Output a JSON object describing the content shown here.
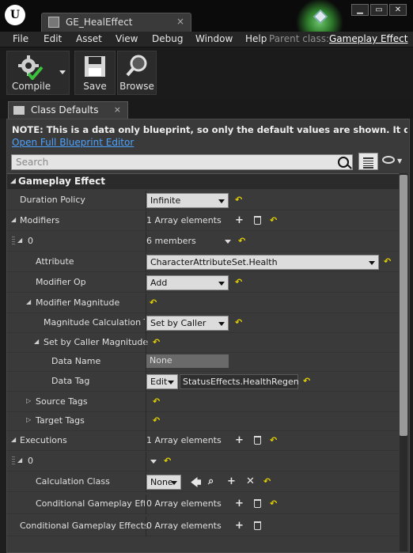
{
  "window": {
    "tab_title": "GE_HealEffect",
    "close_glyph": "×",
    "buttons": [
      "▁",
      "▭",
      "✕"
    ]
  },
  "menu": {
    "items": [
      "File",
      "Edit",
      "Asset",
      "View",
      "Debug",
      "Window",
      "Help"
    ],
    "parent_class_label": "Parent class:",
    "parent_class_value": "Gameplay Effect"
  },
  "toolbar": {
    "compile": "Compile",
    "save": "Save",
    "browse": "Browse"
  },
  "class_tab": {
    "label": "Class Defaults",
    "close": "×"
  },
  "panel": {
    "note": "NOTE: This is a data only blueprint, so only the default values are shown.  It does not have any",
    "link": "Open Full Blueprint Editor",
    "search_placeholder": "Search",
    "category": "Gameplay Effect"
  },
  "rows": {
    "duration_policy": {
      "name": "Duration Policy",
      "value": "Infinite"
    },
    "modifiers": {
      "name": "Modifiers",
      "value": "1 Array elements"
    },
    "mod0": {
      "name": "0",
      "value": "6 members"
    },
    "attribute": {
      "name": "Attribute",
      "value": "CharacterAttributeSet.Health"
    },
    "modifier_op": {
      "name": "Modifier Op",
      "value": "Add"
    },
    "modifier_magnitude": {
      "name": "Modifier Magnitude"
    },
    "mag_calc_type": {
      "name": "Magnitude Calculation Ty",
      "value": "Set by Caller"
    },
    "set_by_caller": {
      "name": "Set by Caller Magnitude"
    },
    "data_name": {
      "name": "Data Name",
      "value": "None"
    },
    "data_tag": {
      "name": "Data Tag",
      "edit": "Edit",
      "value": "StatusEffects.HealthRegen"
    },
    "source_tags": {
      "name": "Source Tags"
    },
    "target_tags": {
      "name": "Target Tags"
    },
    "executions": {
      "name": "Executions",
      "value": "1 Array elements"
    },
    "exec0": {
      "name": "0"
    },
    "calc_class": {
      "name": "Calculation Class",
      "value": "None"
    },
    "cond_ge_inner": {
      "name": "Conditional Gameplay Effec",
      "value": "0 Array elements"
    },
    "cond_ge": {
      "name": "Conditional Gameplay Effects",
      "value": "0 Array elements"
    }
  },
  "icons": {
    "reset": "↶",
    "add": "+",
    "clear": "✕",
    "back": "🡄",
    "find": "⌕",
    "expanded": "◢",
    "collapsed": "▷"
  },
  "colors": {
    "reset_arrow": "#e6d200",
    "link": "#4da3ff",
    "panel_bg": "#3a3a3a"
  }
}
